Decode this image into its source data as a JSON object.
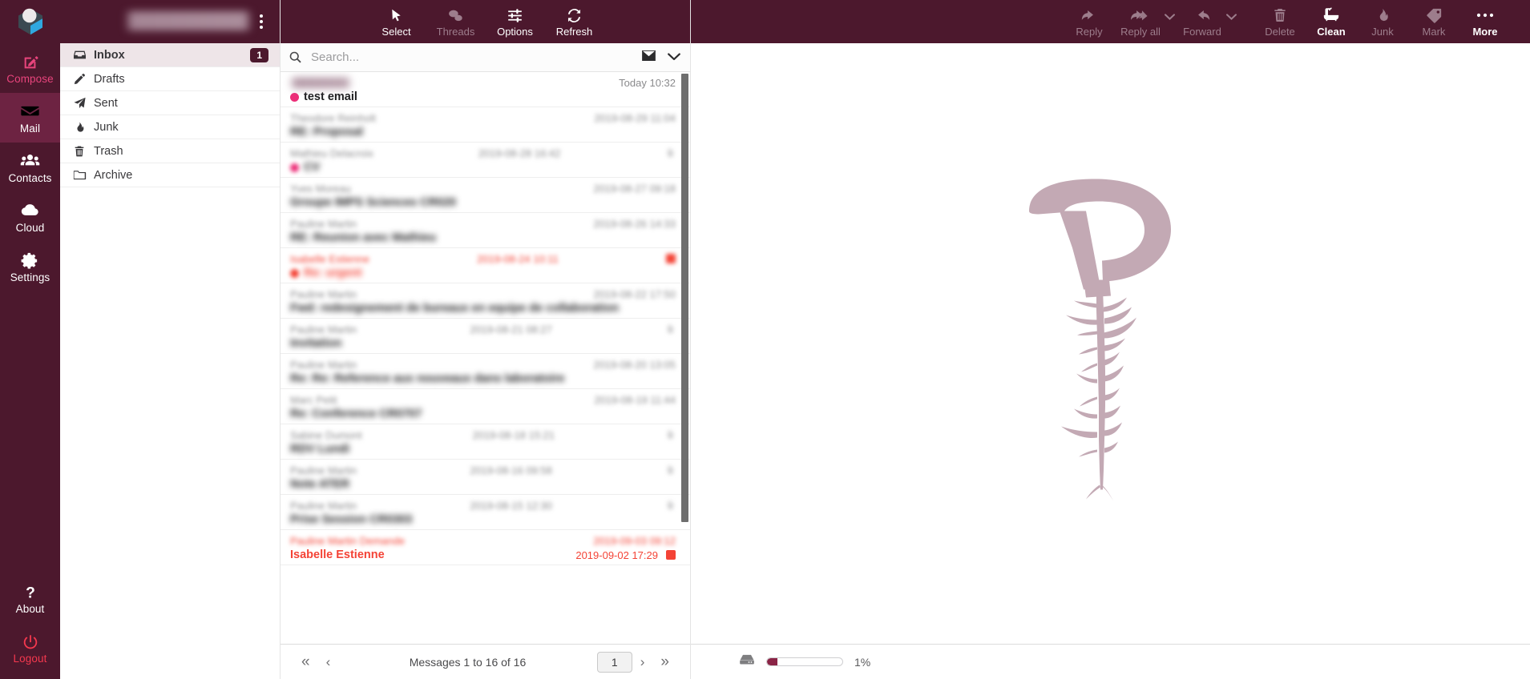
{
  "theme": {
    "brand_dark": "#4c182d",
    "brand_selected": "#6d2342",
    "accent_pink": "#e8447c",
    "danger_red": "#f5384e",
    "unread_dot": "#ec2e78",
    "flag_red": "#f44336",
    "watermark": "#c3a9b4"
  },
  "rail": {
    "logo_icon": "roundcube-logo-icon",
    "items": [
      {
        "id": "compose",
        "label": "Compose",
        "icon": "pencil-square-icon",
        "state": "accent"
      },
      {
        "id": "mail",
        "label": "Mail",
        "icon": "envelope-icon",
        "state": "selected"
      },
      {
        "id": "contacts",
        "label": "Contacts",
        "icon": "people-icon",
        "state": "normal"
      },
      {
        "id": "cloud",
        "label": "Cloud",
        "icon": "cloud-icon",
        "state": "normal"
      },
      {
        "id": "settings",
        "label": "Settings",
        "icon": "gear-icon",
        "state": "normal"
      }
    ],
    "bottom_items": [
      {
        "id": "about",
        "label": "About",
        "icon": "question-mark-icon",
        "state": "normal"
      },
      {
        "id": "logout",
        "label": "Logout",
        "icon": "power-icon",
        "state": "danger"
      }
    ]
  },
  "folders_header": {
    "account_label": "",
    "account_redacted": true,
    "menu_icon": "kebab-menu-icon"
  },
  "folders": [
    {
      "id": "inbox",
      "label": "Inbox",
      "icon": "inbox-icon",
      "badge": "1",
      "active": true
    },
    {
      "id": "drafts",
      "label": "Drafts",
      "icon": "pencil-icon",
      "badge": "",
      "active": false
    },
    {
      "id": "sent",
      "label": "Sent",
      "icon": "paper-plane-icon",
      "badge": "",
      "active": false
    },
    {
      "id": "junk",
      "label": "Junk",
      "icon": "fire-icon",
      "badge": "",
      "active": false
    },
    {
      "id": "trash",
      "label": "Trash",
      "icon": "trash-icon",
      "badge": "",
      "active": false
    },
    {
      "id": "archive",
      "label": "Archive",
      "icon": "folder-icon",
      "badge": "",
      "active": false
    }
  ],
  "list_toolbar": [
    {
      "id": "select",
      "label": "Select",
      "icon": "cursor-arrow-icon",
      "disabled": false
    },
    {
      "id": "threads",
      "label": "Threads",
      "icon": "threads-icon",
      "disabled": true
    },
    {
      "id": "options",
      "label": "Options",
      "icon": "sliders-icon",
      "disabled": false
    },
    {
      "id": "refresh",
      "label": "Refresh",
      "icon": "refresh-icon",
      "disabled": false
    }
  ],
  "search": {
    "value": "",
    "placeholder": "Search...",
    "search_icon": "search-icon",
    "scope_icon": "envelope-icon",
    "dropdown_icon": "chevron-down-icon"
  },
  "messages": [
    {
      "from": "",
      "subject": "test email",
      "date": "Today 10:32",
      "unread": true,
      "redacted": false,
      "flagged": false,
      "attachment": false
    },
    {
      "from": "REDACTED",
      "subject": "REDACTED",
      "date": "REDACTED",
      "unread": false,
      "redacted": true,
      "flagged": false,
      "attachment": false
    },
    {
      "from": "REDACTED",
      "subject": "REDACTED",
      "date": "REDACTED",
      "unread": false,
      "redacted": true,
      "flagged": false,
      "attachment": true
    },
    {
      "from": "REDACTED",
      "subject": "REDACTED",
      "date": "REDACTED",
      "unread": false,
      "redacted": true,
      "flagged": false,
      "attachment": false
    },
    {
      "from": "REDACTED",
      "subject": "REDACTED",
      "date": "REDACTED",
      "unread": false,
      "redacted": true,
      "flagged": false,
      "attachment": false
    },
    {
      "from": "REDACTED",
      "subject": "REDACTED",
      "date": "REDACTED",
      "unread": true,
      "redacted": true,
      "flagged": true,
      "attachment": false
    },
    {
      "from": "REDACTED",
      "subject": "REDACTED",
      "date": "REDACTED",
      "unread": false,
      "redacted": true,
      "flagged": false,
      "attachment": false
    },
    {
      "from": "REDACTED",
      "subject": "REDACTED",
      "date": "REDACTED",
      "unread": false,
      "redacted": true,
      "flagged": false,
      "attachment": true
    },
    {
      "from": "REDACTED",
      "subject": "REDACTED",
      "date": "REDACTED",
      "unread": false,
      "redacted": true,
      "flagged": false,
      "attachment": false
    },
    {
      "from": "REDACTED",
      "subject": "REDACTED",
      "date": "REDACTED",
      "unread": false,
      "redacted": true,
      "flagged": false,
      "attachment": false
    },
    {
      "from": "REDACTED",
      "subject": "REDACTED",
      "date": "REDACTED",
      "unread": false,
      "redacted": true,
      "flagged": false,
      "attachment": true
    },
    {
      "from": "REDACTED",
      "subject": "REDACTED",
      "date": "REDACTED",
      "unread": false,
      "redacted": true,
      "flagged": false,
      "attachment": true
    },
    {
      "from": "REDACTED",
      "subject": "REDACTED",
      "date": "REDACTED",
      "unread": false,
      "redacted": true,
      "flagged": false,
      "attachment": true
    },
    {
      "from": "Isabelle Estienne",
      "subject": "REDACTED",
      "date": "2019-09-02 17:29",
      "unread": false,
      "redacted": false,
      "flagged": true,
      "attachment": false
    }
  ],
  "pagination": {
    "first_icon": "double-chevron-left-icon",
    "prev_icon": "chevron-left-icon",
    "count_text": "Messages 1 to 16 of 16",
    "page_value": "1",
    "next_icon": "chevron-right-icon",
    "last_icon": "double-chevron-right-icon"
  },
  "main_toolbar": [
    {
      "id": "reply",
      "label": "Reply",
      "icon": "reply-icon",
      "active": false,
      "caret": false
    },
    {
      "id": "reply-all",
      "label": "Reply all",
      "icon": "reply-all-icon",
      "active": false,
      "caret": true
    },
    {
      "id": "forward",
      "label": "Forward",
      "icon": "forward-icon",
      "active": false,
      "caret": true
    },
    {
      "id": "delete",
      "label": "Delete",
      "icon": "trash-icon",
      "active": false,
      "caret": false
    },
    {
      "id": "clean",
      "label": "Clean",
      "icon": "bathtub-icon",
      "active": true,
      "caret": false
    },
    {
      "id": "junk",
      "label": "Junk",
      "icon": "fire-icon",
      "active": false,
      "caret": false
    },
    {
      "id": "mark",
      "label": "Mark",
      "icon": "tag-icon",
      "active": false,
      "caret": false
    },
    {
      "id": "more",
      "label": "More",
      "icon": "ellipsis-icon",
      "active": true,
      "caret": false
    }
  ],
  "watermark": {
    "name": "p-with-taproot-logo-watermark"
  },
  "quota": {
    "icon": "server-disk-icon",
    "percent_label": "1%",
    "percent_value": 14
  }
}
